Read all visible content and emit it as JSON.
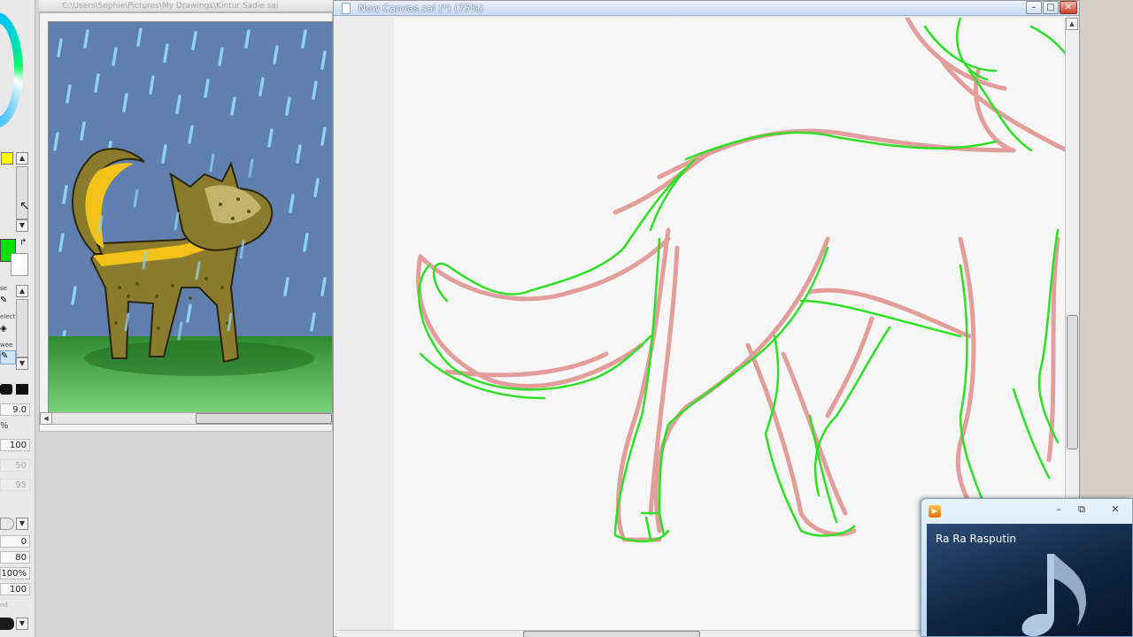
{
  "navigator": {
    "title": "C:\\Users\\Sophie\\Pictures\\My Drawings\\Kintur Sadie.sai"
  },
  "canvas_window": {
    "title": "New Canvas.sai (*) (75%)",
    "minimize": "–",
    "maximize": "□",
    "close": "✕"
  },
  "tool_strip": {
    "brush_size": "9.0",
    "percent_symbol": "%",
    "density": "100",
    "dim_value_1": "50",
    "dim_value_2": "95",
    "value_zero": "0",
    "value_80": "80",
    "value_100pct": "100%",
    "value_100": "100",
    "label_se": "se",
    "label_elect": "elect",
    "label_wee": "wee",
    "label_nd": "nd"
  },
  "player": {
    "track_title": "Ra Ra Rasputin",
    "minimize": "–",
    "restore": "⧉",
    "close": "✕"
  },
  "colors": {
    "primary": "#00e000",
    "secondary": "#ffffff",
    "swatch_yellow": "#ffff00",
    "pink_sketch": "#e29a98",
    "green_lines": "#2ee024"
  }
}
